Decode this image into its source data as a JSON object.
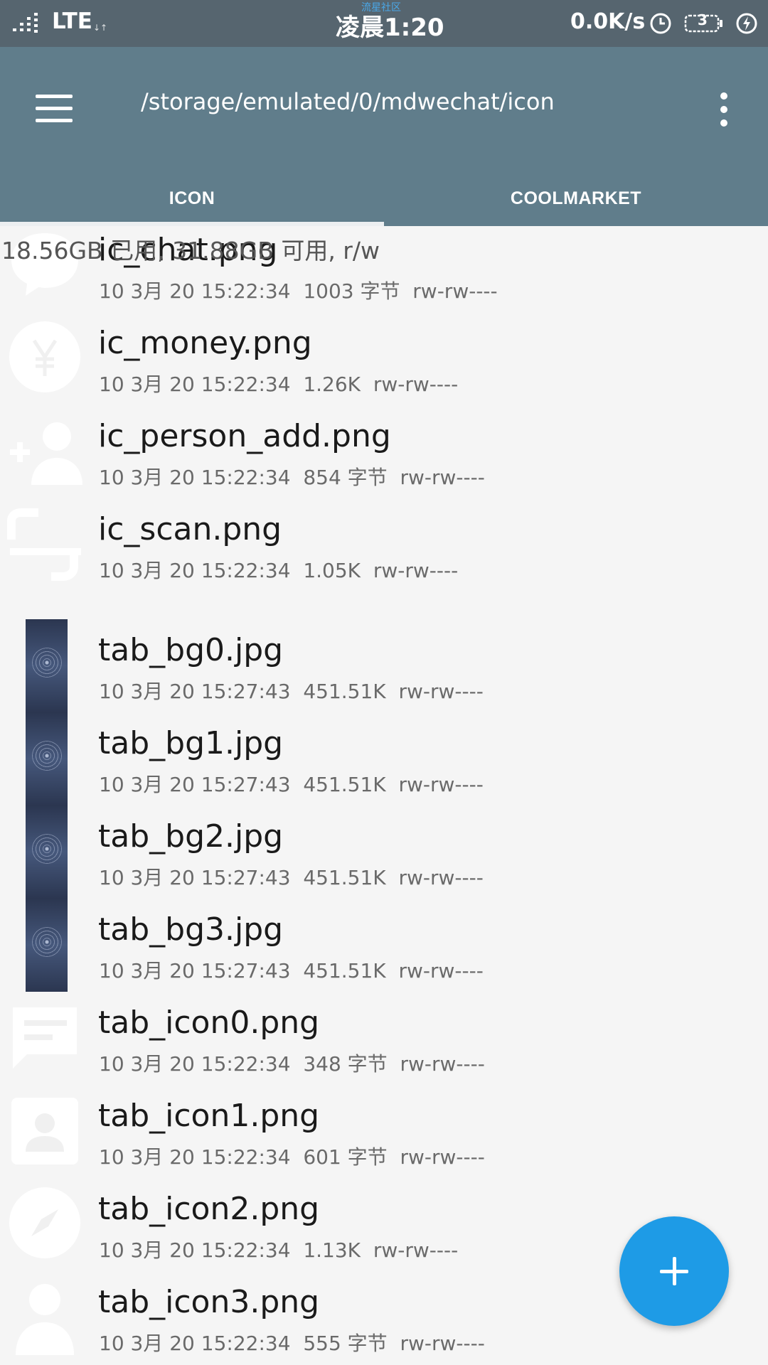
{
  "status_bar": {
    "network": "LTE",
    "network_sub": "↓↑",
    "watermark": "流星社区",
    "time": "凌晨1:20",
    "speed": "0.0K/s",
    "battery_level": "3",
    "icons": [
      "signal-icon",
      "alarm-icon",
      "battery-icon",
      "charging-icon"
    ]
  },
  "app_bar": {
    "path": "/storage/emulated/0/mdwechat/icon",
    "menu_icon": "hamburger-menu-icon",
    "more_icon": "more-vertical-icon",
    "background": "#607d8b"
  },
  "tabs": [
    {
      "label": "ICON",
      "selected": true
    },
    {
      "label": "COOLMARKET",
      "selected": false
    }
  ],
  "storage_info": "18.56GB 已用, 31.88GB 可用, r/w",
  "files": [
    {
      "name": "ic_chat.png",
      "meta": "10 3月 20 15:22:34  1003 字节  rw-rw----",
      "thumb": "chat-bubble-icon"
    },
    {
      "name": "ic_money.png",
      "meta": "10 3月 20 15:22:34  1.26K  rw-rw----",
      "thumb": "yen-icon"
    },
    {
      "name": "ic_person_add.png",
      "meta": "10 3月 20 15:22:34  854 字节  rw-rw----",
      "thumb": "person-add-icon"
    },
    {
      "name": "ic_scan.png",
      "meta": "10 3月 20 15:22:34  1.05K  rw-rw----",
      "thumb": "scan-icon"
    },
    {
      "name": "tab_bg0.jpg",
      "meta": "10 3月 20 15:27:43  451.51K  rw-rw----",
      "thumb": "photo-thumbnail"
    },
    {
      "name": "tab_bg1.jpg",
      "meta": "10 3月 20 15:27:43  451.51K  rw-rw----",
      "thumb": "photo-thumbnail"
    },
    {
      "name": "tab_bg2.jpg",
      "meta": "10 3月 20 15:27:43  451.51K  rw-rw----",
      "thumb": "photo-thumbnail"
    },
    {
      "name": "tab_bg3.jpg",
      "meta": "10 3月 20 15:27:43  451.51K  rw-rw----",
      "thumb": "photo-thumbnail"
    },
    {
      "name": "tab_icon0.png",
      "meta": "10 3月 20 15:22:34  348 字节  rw-rw----",
      "thumb": "message-icon"
    },
    {
      "name": "tab_icon1.png",
      "meta": "10 3月 20 15:22:34  601 字节  rw-rw----",
      "thumb": "contact-card-icon"
    },
    {
      "name": "tab_icon2.png",
      "meta": "10 3月 20 15:22:34  1.13K  rw-rw----",
      "thumb": "compass-icon"
    },
    {
      "name": "tab_icon3.png",
      "meta": "10 3月 20 15:22:34  555 字节  rw-rw----",
      "thumb": "person-icon"
    }
  ],
  "fab": {
    "icon": "plus-icon",
    "color": "#1e9be6"
  }
}
